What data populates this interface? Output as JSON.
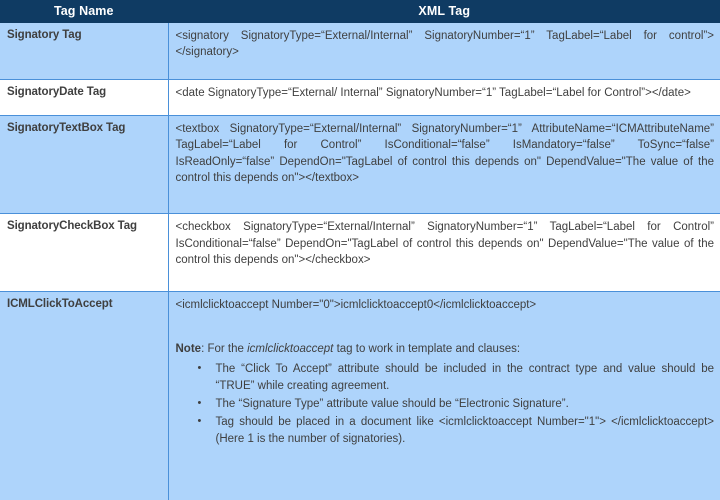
{
  "table": {
    "headers": {
      "tag_name": "Tag Name",
      "xml_tag": "XML Tag"
    },
    "colors": {
      "header_bg": "#0F3B63",
      "header_text": "#FFFFFF",
      "row_shaded_bg": "#AED4FB",
      "row_plain_bg": "#FFFFFF",
      "grid_line": "#4A90D9",
      "body_text": "#3F3F3F"
    },
    "rows": [
      {
        "tag_name": "Signatory Tag",
        "xml_tag": "<signatory SignatoryType=“External/Internal” SignatoryNumber=“1” TagLabel=“Label for control”> </signatory>"
      },
      {
        "tag_name": "SignatoryDate Tag",
        "xml_tag": "<date SignatoryType=“External/ Internal” SignatoryNumber=“1” TagLabel=“Label for Control”></date>"
      },
      {
        "tag_name": "SignatoryTextBox Tag",
        "xml_tag": "<textbox SignatoryType=“External/Internal” SignatoryNumber=“1” AttributeName=“ICMAttributeName” TagLabel=“Label for Control” IsConditional=“false” IsMandatory=“false” ToSync=“false” IsReadOnly=“false” DependOn=\"TagLabel of control this depends on\" DependValue=\"The value of the control this depends on\"></textbox>"
      },
      {
        "tag_name": "SignatoryCheckBox Tag",
        "xml_tag": "<checkbox SignatoryType=“External/Internal” SignatoryNumber=“1” TagLabel=“Label for Control” IsConditional=“false” DependOn=\"TagLabel of control this depends on\" DependValue=\"The value of the control this depends on\"></checkbox>"
      },
      {
        "tag_name": "ICMLClickToAccept",
        "xml_tag": "<icmlclicktoaccept Number=\"0\">icmlclicktoaccept0</icmlclicktoaccept>"
      }
    ]
  },
  "note": {
    "label": "Note",
    "intro_before": ": For the ",
    "emphasis": "icmlclicktoaccept",
    "intro_after": " tag to work in template and clauses:",
    "bullet_glyph": "•",
    "bullets": [
      "The “Click To Accept” attribute should be included in the contract type and value should be “TRUE” while creating agreement.",
      "The “Signature Type” attribute value should be “Electronic Signature”.",
      "Tag should be placed in a document like <icmlclicktoaccept Number=\"1\"> </icmlclicktoaccept> (Here 1 is the number of signatories)."
    ]
  }
}
